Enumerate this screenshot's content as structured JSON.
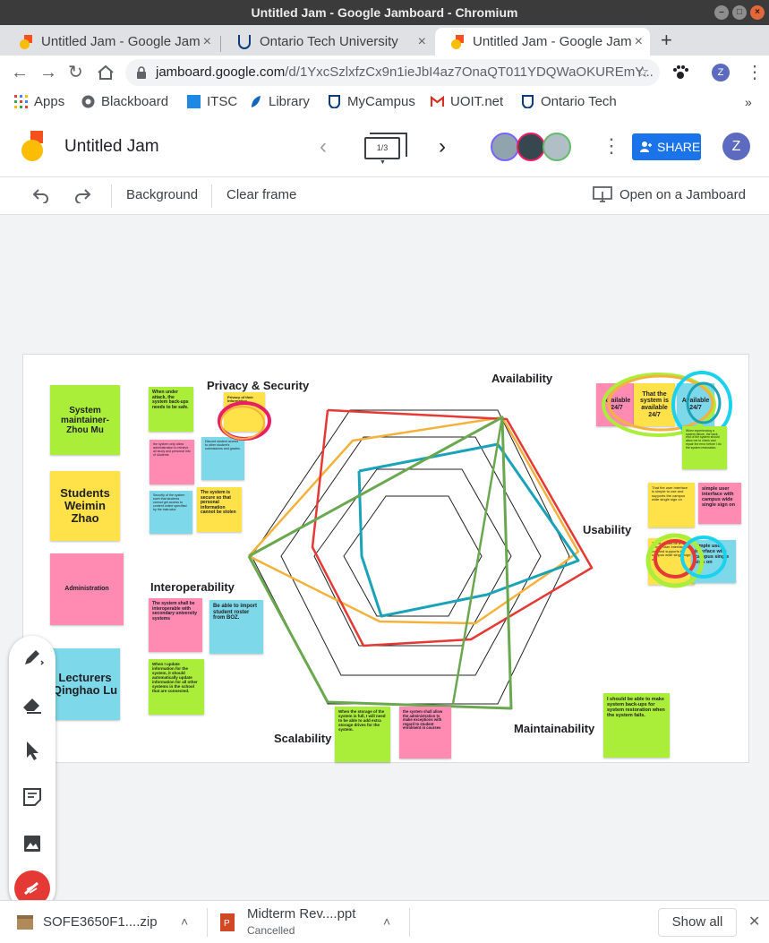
{
  "window": {
    "title": "Untitled Jam - Google Jamboard - Chromium"
  },
  "tabs": [
    {
      "label": "Untitled Jam - Google Jam",
      "active": false
    },
    {
      "label": "Ontario Tech University",
      "active": false
    },
    {
      "label": "Untitled Jam - Google Jam",
      "active": true
    }
  ],
  "new_tab_label": "+",
  "address": {
    "host": "jamboard.google.com",
    "path": "/d/1YxcSzlxfzCx9n1ieJbI4az7OnaQT011YDQWaOKUREmY..."
  },
  "bookmarks": [
    "Apps",
    "Blackboard",
    "ITSC",
    "Library",
    "MyCampus",
    "UOIT.net",
    "Ontario Tech"
  ],
  "bookmarks_more": "»",
  "jam": {
    "title": "Untitled Jam",
    "frame_indicator": "1/3",
    "share_label": "SHARE",
    "user_initial": "Z",
    "profile_initial": "Z"
  },
  "toolbar": {
    "background_label": "Background",
    "clear_frame_label": "Clear frame",
    "open_label": "Open on a Jamboard"
  },
  "board": {
    "axes": {
      "privacy": "Privacy & Security",
      "availability": "Availability",
      "usability": "Usability",
      "maintainability": "Maintainability",
      "scalability": "Scalability",
      "interoperability": "Interoperability"
    },
    "names": {
      "zhou": "System maintainer- Zhou Mu",
      "weimin": "Students Weimin Zhao",
      "admin": "Administration",
      "qinghao": "Lecturers Qinghao Lu"
    },
    "notes": {
      "attack": "When under attack, the system back-ups needs to be safe.",
      "privacy_info": "Privacy of their information",
      "admin_access": "the system only allow administration to retrieve all study and personal info of students",
      "discord": "Discord student access to other student's submissions and grades.",
      "security_access": "Security of the system such that students cannot get access to content online specified by the instructor.",
      "secure_personal": "The system is secure so that personal information cannot be stolen",
      "avail_left": "Available 24/7",
      "avail_mid": "That the system is available 24/7",
      "avail_right": "Available 24/7",
      "failure": "When experiencing a system failure, the back end of the system should allow me to check and repair the error before I do the system restoration.",
      "ui_simple": "That the user interface is simple to use and supports the campus wide single sign on",
      "ui_single": "simple user interface with campus wide single sign on",
      "ui_simple_2": "There should be a simple user interface to use and supports the campus wide single sign on",
      "ui_single_2": "simple user interface with campus single sign on",
      "interop_secondary": "The system shall be interoperable with secondary university systems",
      "import_roster": "Be able to import student roster from BOZ.",
      "update_info": "When I update information for the system, it should automatically update information for all other systems in the school that are connected.",
      "storage_full": "When the storage of the system is full, I will need to be able to add extra storage drives for the system.",
      "exceptions": "the system shall allow the administration to make exceptions with regard to student enrolment in courses",
      "backups": "I should be able to make system back-ups for system restoration when the system fails."
    }
  },
  "downloads": [
    {
      "name": "SOFE3650F1....zip",
      "status": ""
    },
    {
      "name": "Midterm Rev....ppt",
      "status": "Cancelled"
    }
  ],
  "show_all_label": "Show all",
  "colors": {
    "green": "#aaee3a",
    "yellow": "#ffe14a",
    "pink": "#ff8ab2",
    "cyan": "#7dd8ea",
    "share": "#1a73e8",
    "red_stroke": "#e53935",
    "orange_stroke": "#f4b23c",
    "teal_stroke": "#1aa3b8",
    "green_stroke": "#6aa84f"
  }
}
